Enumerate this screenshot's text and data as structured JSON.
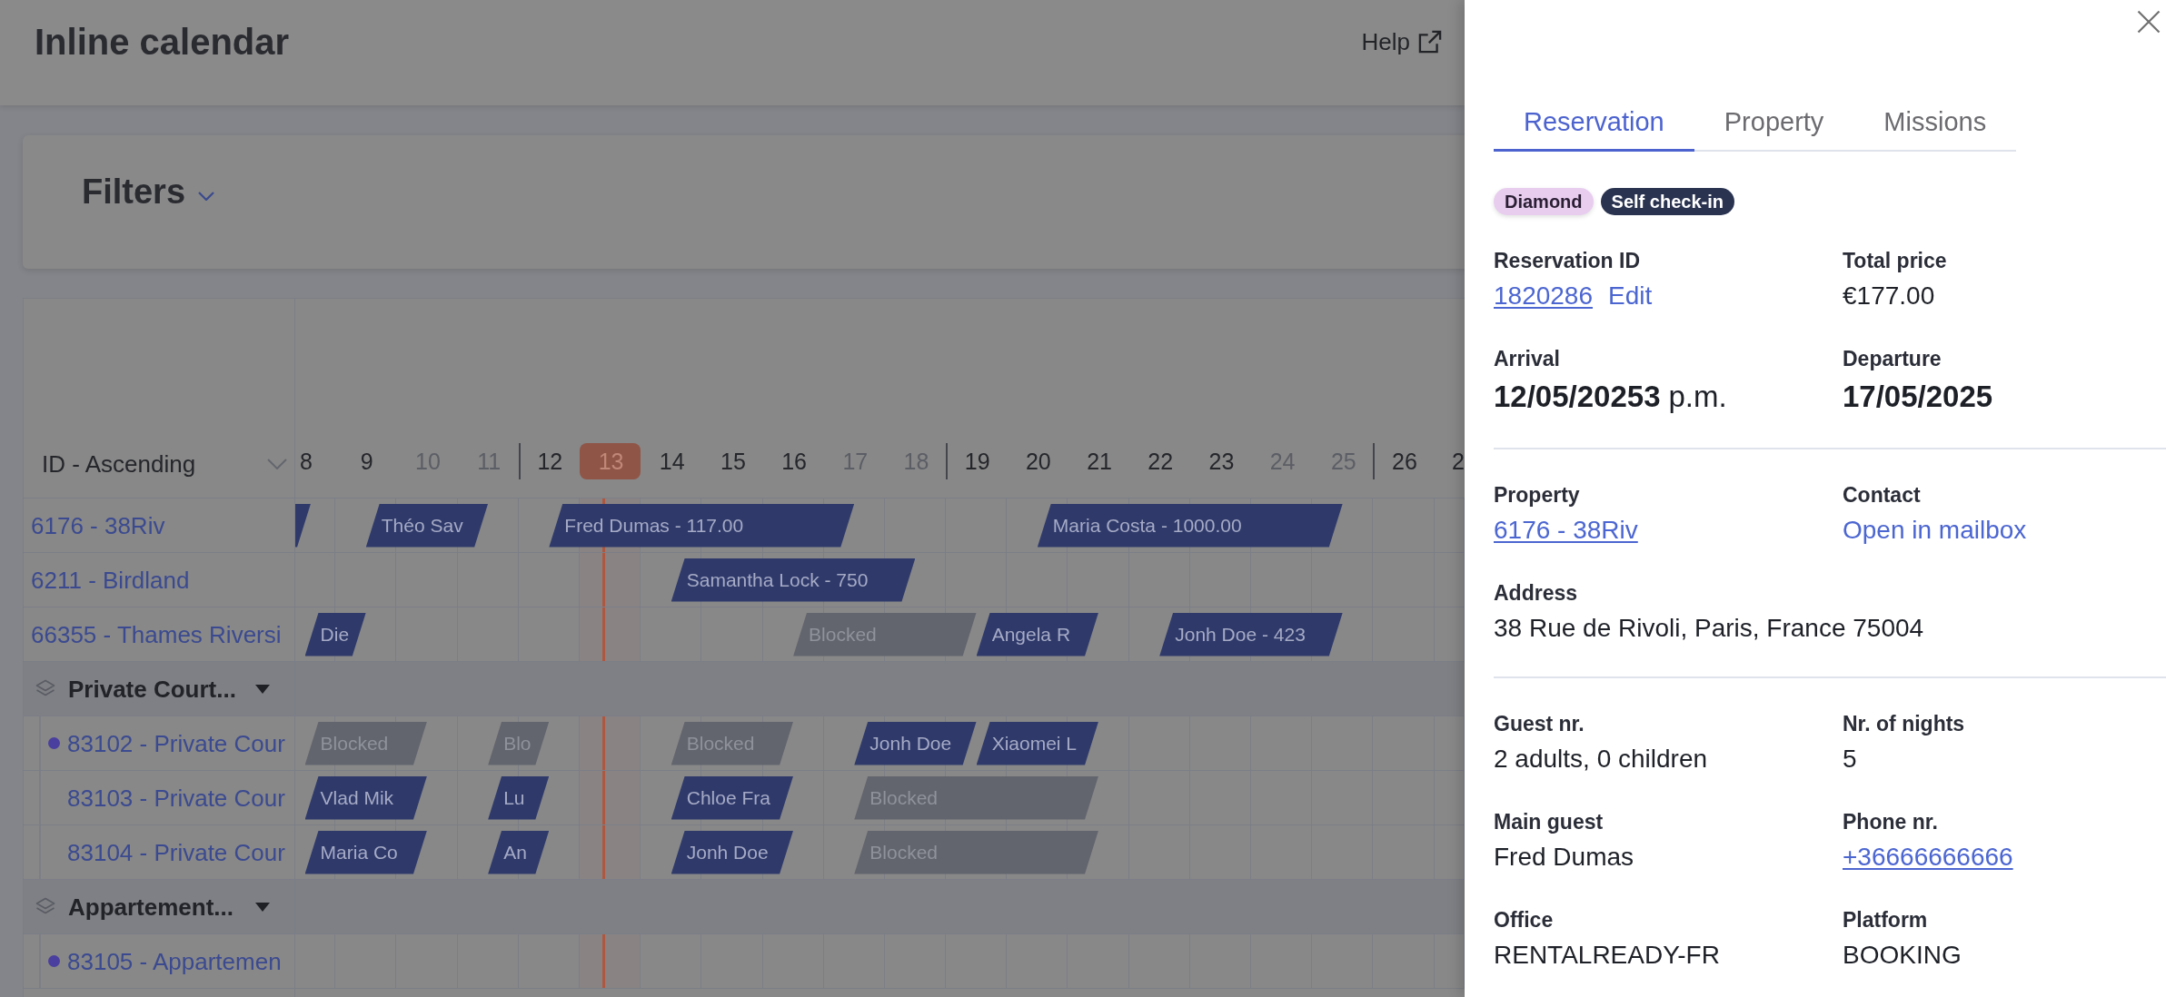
{
  "header": {
    "title": "Inline calendar",
    "help": "Help"
  },
  "filters": {
    "label": "Filters",
    "expanded": false
  },
  "calendar": {
    "sort": "ID - Ascending",
    "days": [
      {
        "label": "8",
        "weekend": false,
        "week_start": false,
        "today": false
      },
      {
        "label": "9",
        "weekend": false,
        "week_start": false,
        "today": false
      },
      {
        "label": "10",
        "weekend": true,
        "week_start": false,
        "today": false
      },
      {
        "label": "11",
        "weekend": true,
        "week_start": false,
        "today": false
      },
      {
        "label": "12",
        "weekend": false,
        "week_start": true,
        "today": false
      },
      {
        "label": "13",
        "weekend": false,
        "week_start": false,
        "today": true
      },
      {
        "label": "14",
        "weekend": false,
        "week_start": false,
        "today": false
      },
      {
        "label": "15",
        "weekend": false,
        "week_start": false,
        "today": false
      },
      {
        "label": "16",
        "weekend": false,
        "week_start": false,
        "today": false
      },
      {
        "label": "17",
        "weekend": true,
        "week_start": false,
        "today": false
      },
      {
        "label": "18",
        "weekend": true,
        "week_start": false,
        "today": false
      },
      {
        "label": "19",
        "weekend": false,
        "week_start": true,
        "today": false
      },
      {
        "label": "20",
        "weekend": false,
        "week_start": false,
        "today": false
      },
      {
        "label": "21",
        "weekend": false,
        "week_start": false,
        "today": false
      },
      {
        "label": "22",
        "weekend": false,
        "week_start": false,
        "today": false
      },
      {
        "label": "23",
        "weekend": false,
        "week_start": false,
        "today": false
      },
      {
        "label": "24",
        "weekend": true,
        "week_start": false,
        "today": false
      },
      {
        "label": "25",
        "weekend": true,
        "week_start": false,
        "today": false
      },
      {
        "label": "26",
        "weekend": false,
        "week_start": true,
        "today": false
      },
      {
        "label": "2",
        "weekend": false,
        "week_start": false,
        "today": false
      }
    ],
    "rows": [
      {
        "kind": "property",
        "label": "6176 - 38Riv",
        "cells": [
          {
            "check_out": true
          },
          {
            "check_out": false,
            "check_in": {
              "kind": "booking",
              "label": "Théo Sav"
            }
          },
          {
            "check_out": false
          },
          {
            "check_out": true
          },
          {
            "check_out": false,
            "check_in": {
              "kind": "booking",
              "label": "Fred Dumas - 117.00"
            }
          },
          {
            "check_out": false
          },
          {
            "check_out": false
          },
          {
            "check_out": false
          },
          {
            "check_out": false
          },
          {
            "check_out": true
          },
          {
            "check_out": false
          },
          {
            "check_out": false
          },
          {
            "check_out": false,
            "check_in": {
              "kind": "booking",
              "label": "Maria Costa - 1000.00"
            }
          },
          {
            "check_out": false
          },
          {
            "check_out": false
          },
          {
            "check_out": false
          },
          {
            "check_out": false
          },
          {
            "check_out": true
          },
          {
            "check_out": false
          },
          {
            "check_out": false
          }
        ]
      },
      {
        "kind": "property",
        "label": "6211 - Birdland",
        "cells": [
          {
            "check_out": false
          },
          {
            "check_out": false
          },
          {
            "check_out": false
          },
          {
            "check_out": false
          },
          {
            "check_out": false
          },
          {
            "check_out": false
          },
          {
            "check_out": false,
            "check_in": {
              "kind": "booking",
              "label": "Samantha Lock - 750"
            }
          },
          {
            "check_out": false
          },
          {
            "check_out": false
          },
          {
            "check_out": false
          },
          {
            "check_out": true
          },
          {
            "check_out": false
          },
          {
            "check_out": false
          },
          {
            "check_out": false
          },
          {
            "check_out": false
          },
          {
            "check_out": false
          },
          {
            "check_out": false
          },
          {
            "check_out": false
          },
          {
            "check_out": false
          },
          {
            "check_out": false
          }
        ]
      },
      {
        "kind": "property",
        "label": "66355 - Thames Riversi",
        "cells": [
          {
            "check_out": false,
            "check_in": {
              "kind": "booking",
              "label": "Die"
            }
          },
          {
            "check_out": true
          },
          {
            "check_out": false
          },
          {
            "check_out": false
          },
          {
            "check_out": false
          },
          {
            "check_out": false
          },
          {
            "check_out": false
          },
          {
            "check_out": false
          },
          {
            "check_out": false,
            "check_in": {
              "kind": "blocked",
              "label": "Blocked"
            }
          },
          {
            "check_out": false
          },
          {
            "check_out": false
          },
          {
            "check_out": true,
            "check_in": {
              "kind": "booking",
              "label": "Angela R"
            }
          },
          {
            "check_out": false
          },
          {
            "check_out": true
          },
          {
            "check_out": false,
            "check_in": {
              "kind": "booking",
              "label": "Jonh Doe - 423"
            }
          },
          {
            "check_out": false
          },
          {
            "check_out": false
          },
          {
            "check_out": true
          },
          {
            "check_out": false
          },
          {
            "check_out": false
          }
        ]
      },
      {
        "kind": "group",
        "label": "Private Court...",
        "expanded": true,
        "children": [
          {
            "kind": "property",
            "label": "83102 - Private Cour",
            "color": "#4a3f9e",
            "cells": [
              {
                "check_out": false,
                "check_in": {
                  "kind": "blocked",
                  "label": "Blocked"
                }
              },
              {
                "check_out": false
              },
              {
                "check_out": true
              },
              {
                "check_out": false,
                "check_in": {
                  "kind": "blocked",
                  "label": "Blo"
                }
              },
              {
                "check_out": true
              },
              {
                "check_out": false
              },
              {
                "check_out": false,
                "check_in": {
                  "kind": "blocked",
                  "label": "Blocked"
                }
              },
              {
                "check_out": false
              },
              {
                "check_out": true
              },
              {
                "check_out": false,
                "check_in": {
                  "kind": "booking",
                  "label": "Jonh Doe"
                }
              },
              {
                "check_out": false
              },
              {
                "check_out": true,
                "check_in": {
                  "kind": "booking",
                  "label": "Xiaomei L"
                }
              },
              {
                "check_out": false
              },
              {
                "check_out": true
              },
              {
                "check_out": false
              },
              {
                "check_out": false
              },
              {
                "check_out": false
              },
              {
                "check_out": false
              },
              {
                "check_out": false
              },
              {
                "check_out": false
              }
            ]
          },
          {
            "kind": "property",
            "label": "83103 - Private Cour",
            "cells": [
              {
                "check_out": false,
                "check_in": {
                  "kind": "booking",
                  "label": "Vlad Mik"
                }
              },
              {
                "check_out": false
              },
              {
                "check_out": true
              },
              {
                "check_out": false,
                "check_in": {
                  "kind": "booking",
                  "label": "Lu"
                }
              },
              {
                "check_out": true
              },
              {
                "check_out": false
              },
              {
                "check_out": false,
                "check_in": {
                  "kind": "booking",
                  "label": "Chloe Fra"
                }
              },
              {
                "check_out": false
              },
              {
                "check_out": true
              },
              {
                "check_out": false,
                "check_in": {
                  "kind": "blocked",
                  "label": "Blocked"
                }
              },
              {
                "check_out": false
              },
              {
                "check_out": false
              },
              {
                "check_out": false
              },
              {
                "check_out": true
              },
              {
                "check_out": false
              },
              {
                "check_out": false
              },
              {
                "check_out": false
              },
              {
                "check_out": false
              },
              {
                "check_out": false
              },
              {
                "check_out": false
              }
            ]
          },
          {
            "kind": "property",
            "label": "83104 - Private Cour",
            "cells": [
              {
                "check_out": false,
                "check_in": {
                  "kind": "booking",
                  "label": "Maria Co"
                }
              },
              {
                "check_out": false
              },
              {
                "check_out": true
              },
              {
                "check_out": false,
                "check_in": {
                  "kind": "booking",
                  "label": "An"
                }
              },
              {
                "check_out": true
              },
              {
                "check_out": false
              },
              {
                "check_out": false,
                "check_in": {
                  "kind": "booking",
                  "label": "Jonh Doe"
                }
              },
              {
                "check_out": false
              },
              {
                "check_out": true
              },
              {
                "check_out": false,
                "check_in": {
                  "kind": "blocked",
                  "label": "Blocked"
                }
              },
              {
                "check_out": false
              },
              {
                "check_out": false
              },
              {
                "check_out": false
              },
              {
                "check_out": true
              },
              {
                "check_out": false
              },
              {
                "check_out": false
              },
              {
                "check_out": false
              },
              {
                "check_out": false
              },
              {
                "check_out": false
              },
              {
                "check_out": false
              }
            ]
          }
        ]
      },
      {
        "kind": "group",
        "label": "Appartement...",
        "expanded": true,
        "children": [
          {
            "kind": "property",
            "label": "83105 - Appartemen",
            "color": "#4a3f9e"
          }
        ]
      }
    ]
  },
  "drawer": {
    "tabs": [
      {
        "label": "Reservation",
        "selected": true
      },
      {
        "label": "Property",
        "selected": false
      },
      {
        "label": "Missions",
        "selected": false
      }
    ],
    "tags": [
      {
        "label": "Diamond",
        "color": "#e8cdef"
      },
      {
        "label": "Self check-in",
        "color": "#2a3350"
      }
    ],
    "sections": [
      {
        "fields": [
          {
            "label": "Reservation ID",
            "value": "1820286",
            "kind": "link",
            "action": "Edit"
          },
          {
            "label": "Total price",
            "value": "€177.00",
            "kind": "text"
          },
          {
            "label": "Arrival",
            "value": "12/05/20253",
            "time": "p.m.",
            "kind": "date"
          },
          {
            "label": "Departure",
            "value": "17/05/2025",
            "kind": "date"
          }
        ]
      },
      {
        "fields": [
          {
            "label": "Property",
            "value": "6176 - 38Riv",
            "kind": "link"
          },
          {
            "label": "Contact",
            "value": "Open in mailbox",
            "kind": "action"
          },
          {
            "label": "Address",
            "value": "38 Rue de Rivoli, Paris, France 75004",
            "kind": "text"
          }
        ]
      },
      {
        "fields": [
          {
            "label": "Guest nr.",
            "value": "2 adults, 0 children",
            "kind": "text"
          },
          {
            "label": "Nr. of nights",
            "value": "5",
            "kind": "text"
          },
          {
            "label": "Main guest",
            "value": "Fred Dumas",
            "kind": "text"
          },
          {
            "label": "Phone nr.",
            "value": "+36666666666",
            "kind": "link"
          },
          {
            "label": "Office",
            "value": "RENTALREADY-FR",
            "kind": "text"
          },
          {
            "label": "Platform",
            "value": "BOOKING",
            "kind": "text"
          }
        ]
      }
    ]
  }
}
